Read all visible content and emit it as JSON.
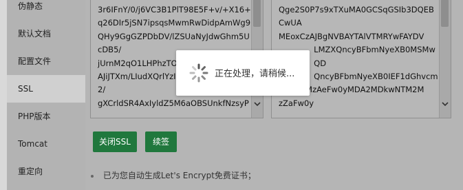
{
  "sidebar": {
    "items": [
      {
        "label": "伪静态"
      },
      {
        "label": "默认文档"
      },
      {
        "label": "配置文件"
      },
      {
        "label": "SSL"
      },
      {
        "label": "PHP版本"
      },
      {
        "label": "Tomcat"
      },
      {
        "label": "重定向"
      }
    ]
  },
  "left_textbox": {
    "text": "3r6IFnY/0/j6VC3B1PlT98E5F+v/+X16+I\nq26DIr5jSN7ipsqsMwmRwDidpAmWg9\nQHy9GgGZPDbDV/lZSUaNyJdwGhm5U\ncDB5/\njUrnM2qO1LHPhzTO\nAJiJTXm/LIudXQrlYzI\n2/\ngXCrldSR4AxIyldZ5M6aOBSUnkfNzsyP"
  },
  "right_textbox": {
    "text": "Qge2S0P7s9xTXuMA0GCSqGSIb3DQEB\nCwUA\nMEoxCzAJBgNVBAYTAlVTMRYwFAYDV\n              LMZXQncyBFbmNyeXB0MSMw\n              QD\n              QncyBFbmNyeXB0IEF1dGhvcm\nl0eSBYMzAeFw0yMDA2MDkwNTM2M\nzZaFw0y"
  },
  "buttons": {
    "close_ssl": "关闭SSL",
    "renew": "续签"
  },
  "tips": {
    "line1": "已为您自动生成Let's Encrypt免费证书；"
  },
  "loading": {
    "text": "正在处理，请稍候..."
  },
  "colors": {
    "button_green": "#20783d",
    "overlay_gray": "#b5b5b5"
  }
}
